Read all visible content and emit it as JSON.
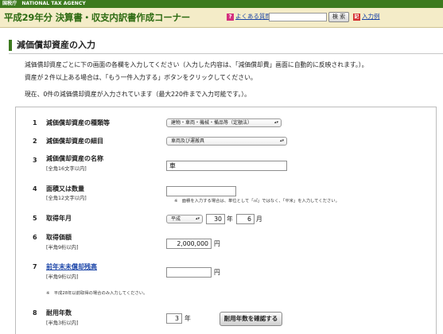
{
  "header": {
    "agency_jp": "国税庁",
    "agency_en": "NATIONAL TAX AGENCY",
    "app_title": "平成29年分 決算書・収支内訳書作成コーナー",
    "faq_icon": "?",
    "faq_label": "よくある質問",
    "search_placeholder": "",
    "search_button": "検 索",
    "input_example_icon": "記",
    "input_example_label": "入力例"
  },
  "section": {
    "title": "減価償却資産の入力"
  },
  "intro": {
    "line1": "減価償却資産ごとに下の画面の各欄を入力してください（入力した内容は、「減価償却費」画面に自動的に反映されます。）。",
    "line2": "資産が２件以上ある場合は、「もう一件入力する」ボタンをクリックしてください。",
    "line3": "現在、0件の減価償却資産が入力されています（最大220件まで入力可能です。）。"
  },
  "form": {
    "rows": [
      {
        "num": "1",
        "label": "減価償却資産の種類等",
        "sub": "",
        "select_value": "建物・車両・機械・備品等（定額法）"
      },
      {
        "num": "2",
        "label": "減価償却資産の細目",
        "sub": "",
        "select_value": "車両及び運搬具"
      },
      {
        "num": "3",
        "label": "減価償却資産の名称",
        "sub": "[全角16文字以内]",
        "value": "車"
      },
      {
        "num": "4",
        "label": "面積又は数量",
        "sub": "[全角12文字以内]",
        "value": "",
        "note": "※　面積を入力する場合は、単位として「㎡」ではなく、「平米」を入力してください。"
      },
      {
        "num": "5",
        "label": "取得年月",
        "sub": "",
        "era": "平成",
        "year": "30",
        "year_unit": "年",
        "month": "6",
        "month_unit": "月"
      },
      {
        "num": "6",
        "label": "取得価額",
        "sub": "[半角9桁以内]",
        "value": "2,000,000",
        "unit": "円"
      },
      {
        "num": "7",
        "label": "前年末未償却残高",
        "sub": "[半角9桁以内]",
        "value": "",
        "unit": "円",
        "note": "※　平成28年以前取得の場合のみ入力してください。"
      },
      {
        "num": "8",
        "label": "耐用年数",
        "sub": "[半角3桁以内]",
        "value": "3",
        "unit": "年",
        "button": "耐用年数を確認する"
      }
    ]
  }
}
